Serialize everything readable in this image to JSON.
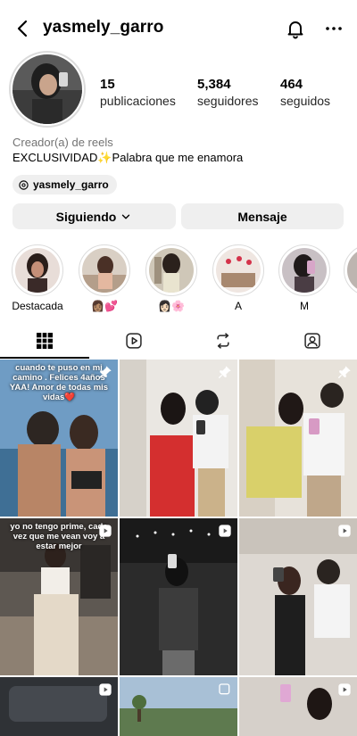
{
  "header": {
    "username": "yasmely_garro"
  },
  "stats": [
    {
      "value": "15",
      "label": "publicaciones"
    },
    {
      "value": "5,384",
      "label": "seguidores"
    },
    {
      "value": "464",
      "label": "seguidos"
    }
  ],
  "profile": {
    "category": "Creador(a) de reels",
    "bio": "EXCLUSIVIDAD✨Palabra que me enamora",
    "threads_handle": "yasmely_garro"
  },
  "buttons": {
    "following": "Siguiendo",
    "message": "Mensaje"
  },
  "highlights": [
    {
      "label": "Destacada"
    },
    {
      "label": "👩🏽💕"
    },
    {
      "label": "👩🏻🌸"
    },
    {
      "label": "A"
    },
    {
      "label": "M"
    }
  ],
  "posts": [
    {
      "overlay": "cuando te puso en mi camino . Felices 4años YAA! Amor de todas mis vidas❤️",
      "badge": "pin-icon"
    },
    {
      "overlay": "",
      "badge": "pin-icon"
    },
    {
      "overlay": "",
      "badge": "pin-icon"
    },
    {
      "overlay": "yo no tengo prime, cada vez que me vean voy a estar mejor",
      "badge": "reel-icon"
    },
    {
      "overlay": "",
      "badge": "reel-icon"
    },
    {
      "overlay": "",
      "badge": "reel-icon"
    },
    {
      "overlay": "",
      "badge": "reel-icon"
    },
    {
      "overlay": "",
      "badge": "carousel-icon"
    },
    {
      "overlay": "",
      "badge": "reel-icon"
    }
  ],
  "colors": {
    "button_bg": "#efefef",
    "secondary_text": "#737373",
    "ring": "#dbdbdb"
  }
}
